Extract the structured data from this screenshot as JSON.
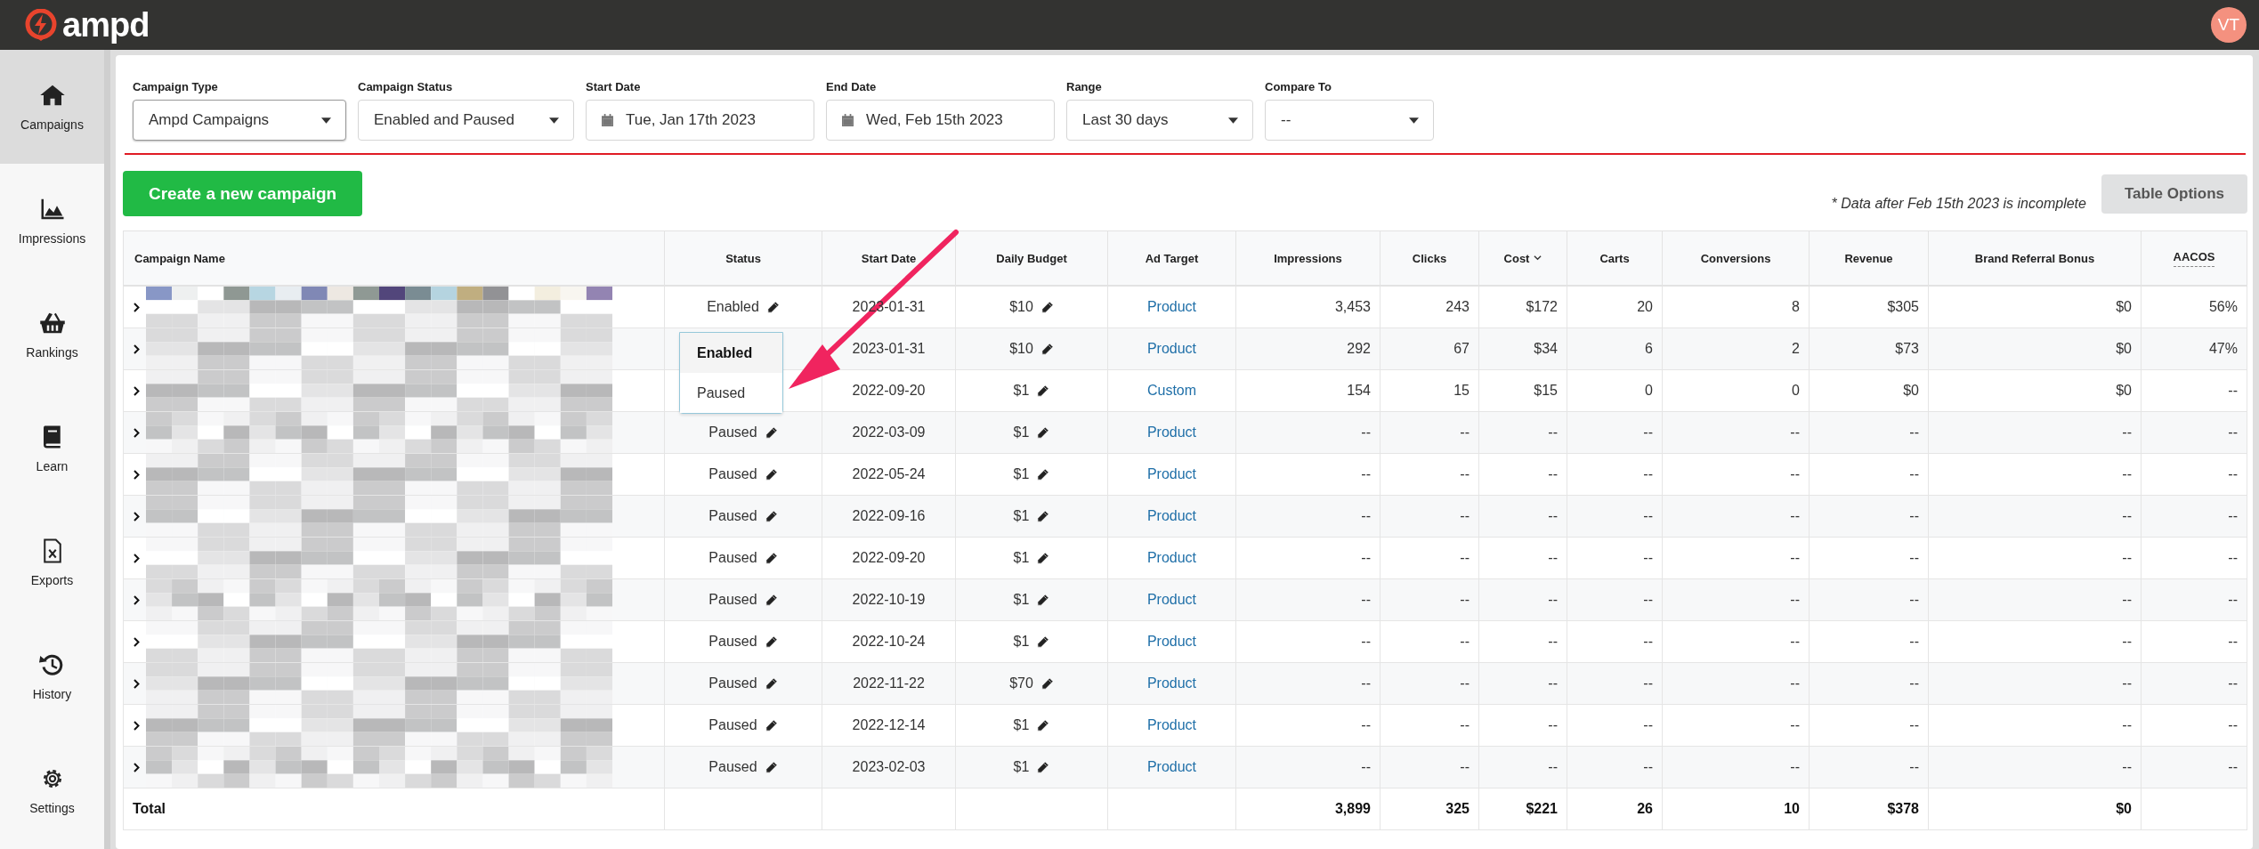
{
  "header": {
    "logo": "ampd",
    "avatar": "VT"
  },
  "sidebar": {
    "items": [
      {
        "label": "Campaigns",
        "selected": true
      },
      {
        "label": "Impressions",
        "selected": false
      },
      {
        "label": "Rankings",
        "selected": false
      },
      {
        "label": "Learn",
        "selected": false
      },
      {
        "label": "Exports",
        "selected": false
      },
      {
        "label": "History",
        "selected": false
      },
      {
        "label": "Settings",
        "selected": false
      }
    ]
  },
  "filters": [
    {
      "label": "Campaign Type",
      "value": "Ampd Campaigns",
      "kind": "select",
      "focused": true
    },
    {
      "label": "Campaign Status",
      "value": "Enabled and Paused",
      "kind": "select",
      "focused": false
    },
    {
      "label": "Start Date",
      "value": "Tue, Jan 17th 2023",
      "kind": "date",
      "focused": false
    },
    {
      "label": "End Date",
      "value": "Wed, Feb 15th 2023",
      "kind": "date",
      "focused": false
    },
    {
      "label": "Range",
      "value": "Last 30 days",
      "kind": "select",
      "focused": false
    },
    {
      "label": "Compare To",
      "value": "--",
      "kind": "select",
      "focused": false
    }
  ],
  "create_button": "Create a new campaign",
  "notice": "* Data after Feb 15th 2023 is incomplete",
  "table_options_button": "Table Options",
  "table": {
    "columns": [
      {
        "label": "Campaign Name",
        "sorted": false,
        "hint": false
      },
      {
        "label": "Status",
        "sorted": false,
        "hint": false
      },
      {
        "label": "Start Date",
        "sorted": false,
        "hint": false
      },
      {
        "label": "Daily Budget",
        "sorted": false,
        "hint": false
      },
      {
        "label": "Ad Target",
        "sorted": false,
        "hint": false
      },
      {
        "label": "Impressions",
        "sorted": false,
        "hint": false
      },
      {
        "label": "Clicks",
        "sorted": false,
        "hint": false
      },
      {
        "label": "Cost",
        "sorted": true,
        "hint": false
      },
      {
        "label": "Carts",
        "sorted": false,
        "hint": false
      },
      {
        "label": "Conversions",
        "sorted": false,
        "hint": false
      },
      {
        "label": "Revenue",
        "sorted": false,
        "hint": false
      },
      {
        "label": "Brand Referral Bonus",
        "sorted": false,
        "hint": false
      },
      {
        "label": "AACOS",
        "sorted": false,
        "hint": true
      }
    ],
    "rows": [
      {
        "status": "Enabled",
        "start_date": "2023-01-31",
        "daily_budget": "$10",
        "ad_target": "Product",
        "metrics": [
          "3,453",
          "243",
          "$172",
          "20",
          "8",
          "$305",
          "$0",
          "56%"
        ],
        "status_menu": {
          "options": [
            {
              "label": "Enabled",
              "selected": true
            },
            {
              "label": "Paused",
              "selected": false
            }
          ]
        }
      },
      {
        "start_date": "2023-01-31",
        "daily_budget": "$10",
        "ad_target": "Product",
        "metrics": [
          "292",
          "67",
          "$34",
          "6",
          "2",
          "$73",
          "$0",
          "47%"
        ]
      },
      {
        "start_date": "2022-09-20",
        "daily_budget": "$1",
        "ad_target": "Custom",
        "metrics": [
          "154",
          "15",
          "$15",
          "0",
          "0",
          "$0",
          "$0",
          "--"
        ]
      },
      {
        "status": "Paused",
        "start_date": "2022-03-09",
        "daily_budget": "$1",
        "ad_target": "Product",
        "metrics": [
          "--",
          "--",
          "--",
          "--",
          "--",
          "--",
          "--",
          "--"
        ]
      },
      {
        "status": "Paused",
        "start_date": "2022-05-24",
        "daily_budget": "$1",
        "ad_target": "Product",
        "metrics": [
          "--",
          "--",
          "--",
          "--",
          "--",
          "--",
          "--",
          "--"
        ]
      },
      {
        "status": "Paused",
        "start_date": "2022-09-16",
        "daily_budget": "$1",
        "ad_target": "Product",
        "metrics": [
          "--",
          "--",
          "--",
          "--",
          "--",
          "--",
          "--",
          "--"
        ]
      },
      {
        "status": "Paused",
        "start_date": "2022-09-20",
        "daily_budget": "$1",
        "ad_target": "Product",
        "metrics": [
          "--",
          "--",
          "--",
          "--",
          "--",
          "--",
          "--",
          "--"
        ]
      },
      {
        "status": "Paused",
        "start_date": "2022-10-19",
        "daily_budget": "$1",
        "ad_target": "Product",
        "metrics": [
          "--",
          "--",
          "--",
          "--",
          "--",
          "--",
          "--",
          "--"
        ]
      },
      {
        "status": "Paused",
        "start_date": "2022-10-24",
        "daily_budget": "$1",
        "ad_target": "Product",
        "metrics": [
          "--",
          "--",
          "--",
          "--",
          "--",
          "--",
          "--",
          "--"
        ]
      },
      {
        "status": "Paused",
        "start_date": "2022-11-22",
        "daily_budget": "$70",
        "ad_target": "Product",
        "metrics": [
          "--",
          "--",
          "--",
          "--",
          "--",
          "--",
          "--",
          "--"
        ]
      },
      {
        "status": "Paused",
        "start_date": "2022-12-14",
        "daily_budget": "$1",
        "ad_target": "Product",
        "metrics": [
          "--",
          "--",
          "--",
          "--",
          "--",
          "--",
          "--",
          "--"
        ]
      },
      {
        "status": "Paused",
        "start_date": "2023-02-03",
        "daily_budget": "$1",
        "ad_target": "Product",
        "metrics": [
          "--",
          "--",
          "--",
          "--",
          "--",
          "--",
          "--",
          "--"
        ]
      }
    ],
    "total": {
      "label": "Total",
      "metrics": [
        "3,899",
        "325",
        "$221",
        "26",
        "10",
        "$378",
        "$0"
      ]
    }
  }
}
